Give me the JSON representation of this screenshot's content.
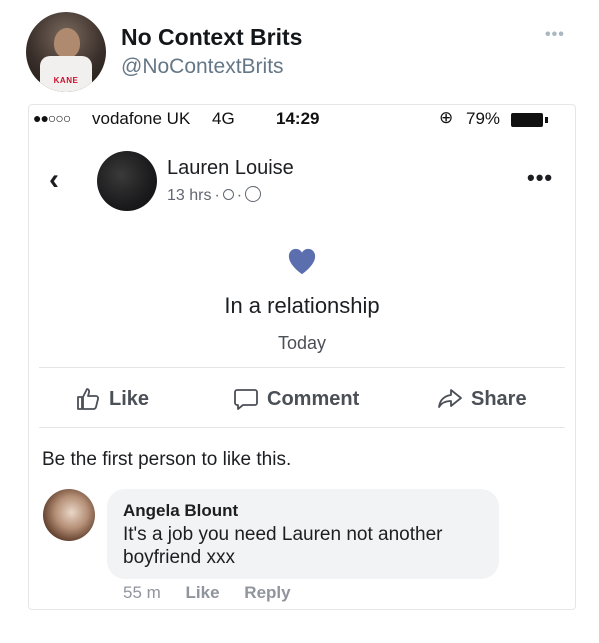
{
  "tweet": {
    "author_name": "No Context Brits",
    "handle": "@NoContextBrits",
    "avatar_shirt_text": "KANE",
    "more_icon": "more-dots-icon"
  },
  "status_bar": {
    "signal": "●●○○○",
    "carrier": "vodafone UK",
    "network": "4G",
    "time": "14:29",
    "lock_icon": "rotation-lock-icon",
    "battery_percent": "79%"
  },
  "post": {
    "poster_name": "Lauren Louise",
    "time_ago": "13 hrs",
    "privacy_icon": "globe-icon",
    "life_event": {
      "icon": "heart-icon",
      "icon_color": "#5b6eae",
      "title": "In a relationship",
      "date": "Today"
    },
    "actions": [
      {
        "label": "Like",
        "icon": "thumbs-up-icon"
      },
      {
        "label": "Comment",
        "icon": "comment-icon"
      },
      {
        "label": "Share",
        "icon": "share-icon"
      }
    ],
    "likes_summary": "Be the first person to like this."
  },
  "comment": {
    "author": "Angela Blount",
    "text": "It's a job you need Lauren not another boyfriend xxx",
    "time_ago": "55 m",
    "like_label": "Like",
    "reply_label": "Reply"
  }
}
